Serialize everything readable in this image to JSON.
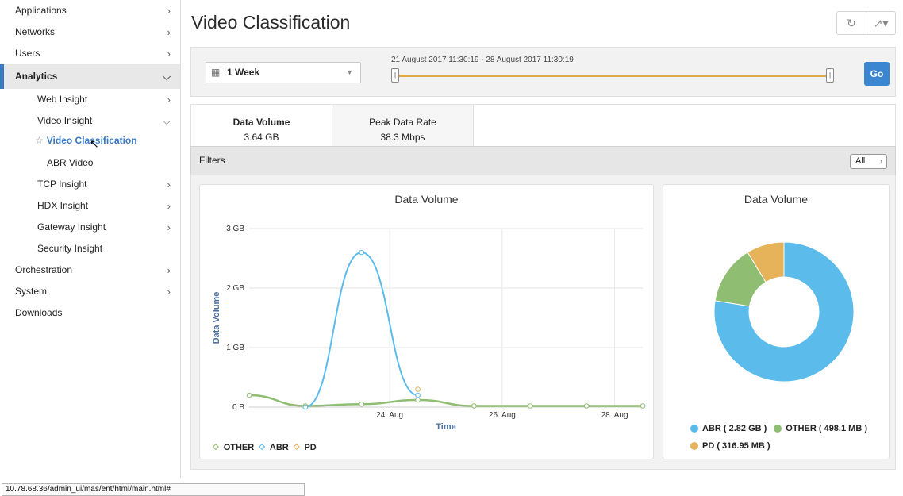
{
  "sidebar": {
    "items": [
      {
        "label": "Applications",
        "chev": ">"
      },
      {
        "label": "Networks",
        "chev": ">"
      },
      {
        "label": "Users",
        "chev": ">"
      },
      {
        "label": "Analytics",
        "chev": "v"
      },
      {
        "label": "Web Insight",
        "chev": ">"
      },
      {
        "label": "Video Insight",
        "chev": "v"
      },
      {
        "label": "Video Classification"
      },
      {
        "label": "ABR Video"
      },
      {
        "label": "TCP Insight",
        "chev": ">"
      },
      {
        "label": "HDX Insight",
        "chev": ">"
      },
      {
        "label": "Gateway Insight",
        "chev": ">"
      },
      {
        "label": "Security Insight"
      },
      {
        "label": "Orchestration",
        "chev": ">"
      },
      {
        "label": "System",
        "chev": ">"
      },
      {
        "label": "Downloads"
      }
    ]
  },
  "page": {
    "title": "Video Classification"
  },
  "filterbar": {
    "period": "1 Week",
    "range_label": "21 August 2017 11:30:19 - 28 August 2017 11:30:19",
    "go_label": "Go"
  },
  "tabs": [
    {
      "label": "Data Volume",
      "value": "3.64 GB"
    },
    {
      "label": "Peak Data Rate",
      "value": "38.3 Mbps"
    }
  ],
  "filters": {
    "label": "Filters",
    "selected": "All"
  },
  "line_panel": {
    "title": "Data Volume"
  },
  "pie_panel": {
    "title": "Data Volume"
  },
  "colors": {
    "abr": "#5bbbea",
    "other": "#8fbd72",
    "pd": "#e6b25a"
  },
  "chart_data": [
    {
      "type": "line",
      "title": "Data Volume",
      "xlabel": "Time",
      "ylabel": "Data Volume",
      "x": [
        "21 Aug",
        "22 Aug",
        "23 Aug",
        "24 Aug",
        "25 Aug",
        "26 Aug",
        "27 Aug",
        "28 Aug"
      ],
      "x_tick_labels": [
        "24. Aug",
        "26. Aug",
        "28. Aug"
      ],
      "y_tick_labels": [
        "0 B",
        "1 GB",
        "2 GB",
        "3 GB"
      ],
      "ylim": [
        0,
        3
      ],
      "series": [
        {
          "name": "OTHER",
          "values": [
            0.2,
            0.02,
            0.05,
            0.12,
            0.02,
            0.02,
            0.02,
            0.02
          ]
        },
        {
          "name": "ABR",
          "values": [
            null,
            0.0,
            2.6,
            0.2,
            null,
            null,
            null,
            null
          ]
        },
        {
          "name": "PD",
          "values": [
            null,
            null,
            null,
            0.3,
            null,
            null,
            null,
            null
          ]
        }
      ],
      "legend": "bottom-left",
      "grid": true
    },
    {
      "type": "pie",
      "title": "Data Volume",
      "slices": [
        {
          "label": "ABR ( 2.82 GB )",
          "value": 2.82
        },
        {
          "label": "OTHER ( 498.1 MB )",
          "value": 0.4981
        },
        {
          "label": "PD ( 316.95 MB )",
          "value": 0.31695
        }
      ]
    }
  ],
  "status_url": "10.78.68.36/admin_ui/mas/ent/html/main.html#"
}
